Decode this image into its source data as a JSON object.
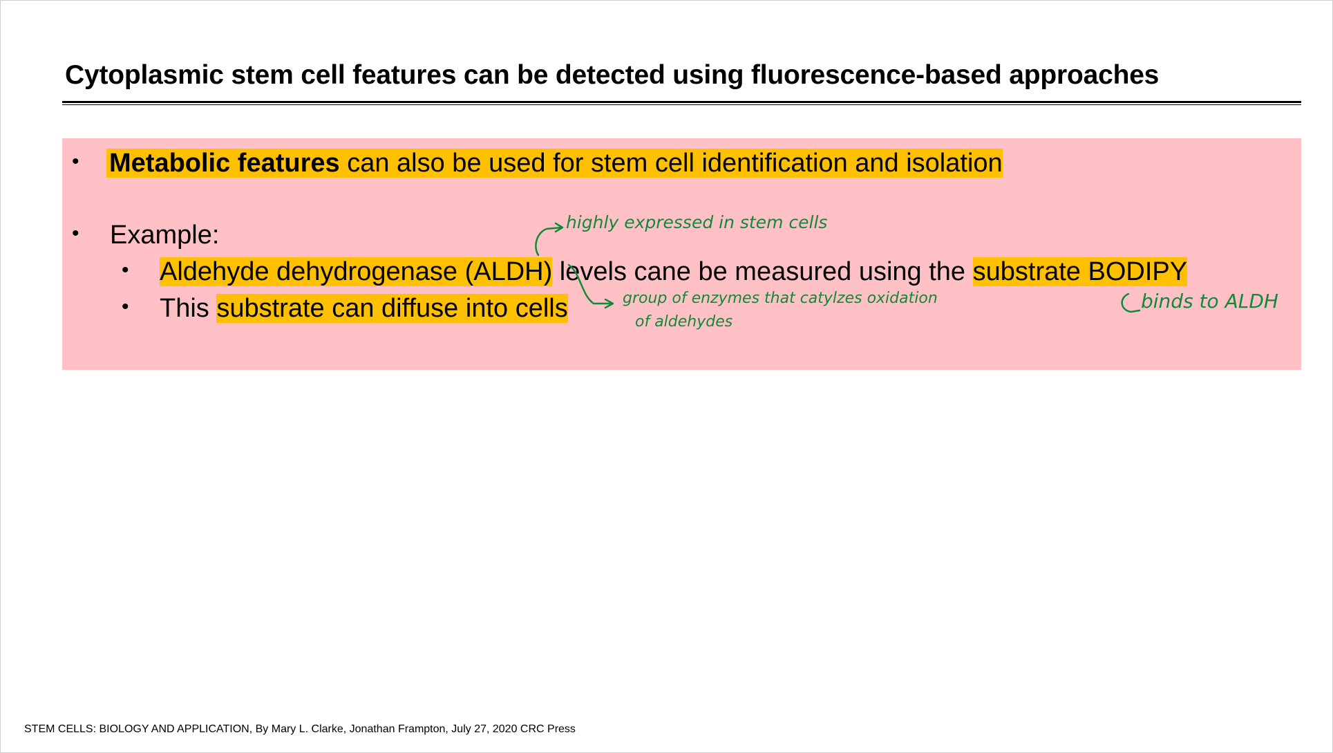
{
  "slide": {
    "title": "Cytoplasmic stem cell features can be detected using fluorescence-based approaches",
    "bullets": [
      {
        "marker": "•",
        "bold_highlight": "Metabolic features",
        "rest_highlight": " can also be used for stem cell identification and isolation "
      },
      {
        "marker": "•",
        "text": "Example:"
      }
    ],
    "sub_bullets": [
      {
        "marker": "•",
        "highlight_1": "Aldehyde dehydrogenase (ALDH)",
        "plain": "  levels cane be measured using the ",
        "highlight_2": "substrate BODIPY"
      },
      {
        "marker": "•",
        "plain": "This ",
        "highlight": "substrate can diffuse into cells"
      }
    ],
    "footer": "STEM CELLS: BIOLOGY AND APPLICATION, By Mary L. Clarke, Jonathan Frampton, July 27, 2020 CRC Press"
  },
  "handwriting": {
    "note_1": "highly expressed in stem cells",
    "note_2_line1": "group of enzymes that catylzes oxidation",
    "note_2_line2": "of aldehydes",
    "note_3": "binds to ALDH"
  },
  "colors": {
    "panel": "#ffc0c6",
    "highlight": "#ffc000",
    "ink": "#0f8a3a"
  }
}
